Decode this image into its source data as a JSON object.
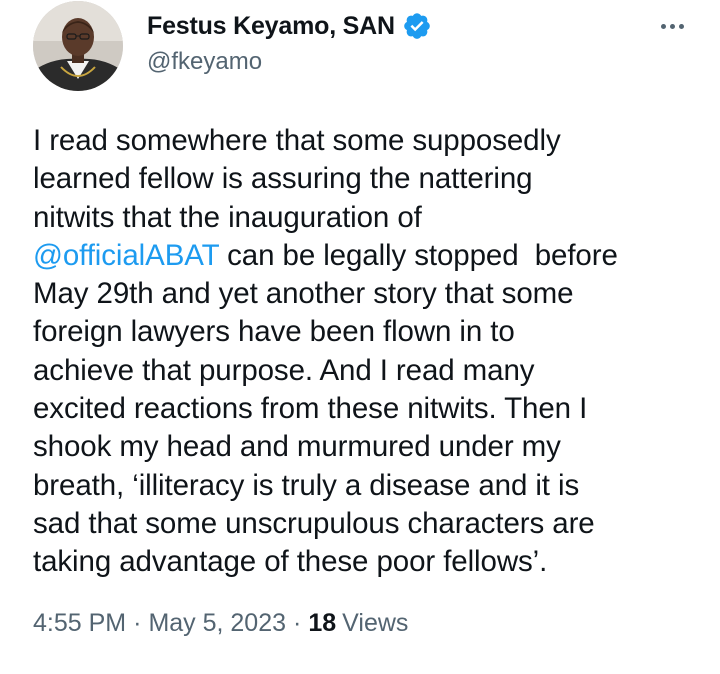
{
  "author": {
    "display_name": "Festus Keyamo, SAN",
    "handle": "@fkeyamo",
    "verified": true,
    "avatar_icon": "profile-photo",
    "verified_icon": "verified-badge-icon",
    "verified_color": "#1d9bf0"
  },
  "menu": {
    "icon": "more-options-icon"
  },
  "tweet": {
    "lines": [
      [
        {
          "text": "I read somewhere that some supposedly"
        }
      ],
      [
        {
          "text": "learned fellow is assuring the nattering"
        }
      ],
      [
        {
          "text": "nitwits that the inauguration of"
        }
      ],
      [
        {
          "text": "@officialABAT",
          "mention": true
        },
        {
          "text": " can be legally stopped  before"
        }
      ],
      [
        {
          "text": "May 29th and yet another story that some"
        }
      ],
      [
        {
          "text": "foreign lawyers have been flown in to"
        }
      ],
      [
        {
          "text": "achieve that purpose. And I read many"
        }
      ],
      [
        {
          "text": "excited reactions from these nitwits. Then I"
        }
      ],
      [
        {
          "text": "shook my head and murmured under my"
        }
      ],
      [
        {
          "text": "breath, ‘illiteracy is truly a disease and it is"
        }
      ],
      [
        {
          "text": "sad that some unscrupulous characters are"
        }
      ],
      [
        {
          "text": "taking advantage of these poor fellows’."
        }
      ]
    ],
    "mention_color": "#1d9bf0"
  },
  "meta": {
    "time": "4:55 PM",
    "separator": "·",
    "date": "May 5, 2023",
    "views_count": "18",
    "views_label": "Views"
  },
  "colors": {
    "text": "#0f1419",
    "secondary": "#536471",
    "background": "#ffffff"
  }
}
